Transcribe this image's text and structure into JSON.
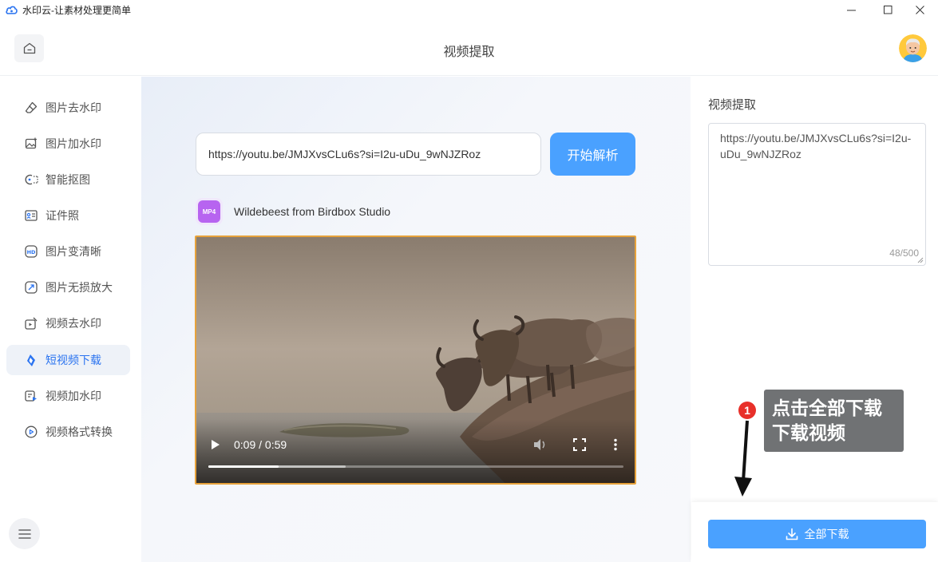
{
  "window": {
    "title": "水印云-让素材处理更简单",
    "controls": [
      "minimize",
      "maximize",
      "close"
    ]
  },
  "header": {
    "page_title": "视频提取",
    "home_icon": "home-icon",
    "avatar": "user-avatar"
  },
  "sidebar": {
    "items": [
      {
        "label": "图片去水印",
        "icon": "eraser-icon",
        "active": false
      },
      {
        "label": "图片加水印",
        "icon": "image-add-icon",
        "active": false
      },
      {
        "label": "智能抠图",
        "icon": "cutout-icon",
        "active": false
      },
      {
        "label": "证件照",
        "icon": "id-card-icon",
        "active": false
      },
      {
        "label": "图片变清晰",
        "icon": "hd-icon",
        "active": false
      },
      {
        "label": "图片无损放大",
        "icon": "enlarge-icon",
        "active": false
      },
      {
        "label": "视频去水印",
        "icon": "video-erase-icon",
        "active": false
      },
      {
        "label": "短视频下载",
        "icon": "douyin-icon",
        "active": true
      },
      {
        "label": "视频加水印",
        "icon": "video-add-icon",
        "active": false
      },
      {
        "label": "视频格式转换",
        "icon": "video-convert-icon",
        "active": false
      }
    ],
    "menu_icon": "menu-icon"
  },
  "main": {
    "url_value": "https://youtu.be/JMJXvsCLu6s?si=I2u-uDu_9wNJZRoz",
    "parse_button": "开始解析",
    "file_badge": "MP4",
    "file_name": "Wildebeest from Birdbox Studio",
    "video": {
      "time": "0:09 / 0:59",
      "progress_fraction": 0.17,
      "buffered_fraction": 0.33
    }
  },
  "right_panel": {
    "title": "视频提取",
    "textarea_value": "https://youtu.be/JMJXvsCLu6s?si=I2u-uDu_9wNJZRoz",
    "char_count": "48/500",
    "download_all_button": "全部下载"
  },
  "annotation": {
    "number": "1",
    "text_line1": "点击全部下载",
    "text_line2": "下载视频"
  },
  "colors": {
    "accent": "#4aa1ff",
    "active_text": "#2b74f0",
    "active_bg": "#eef2f8",
    "video_border": "#e7a23b",
    "callout_bg": "#707274",
    "badge_red": "#e8302a"
  }
}
